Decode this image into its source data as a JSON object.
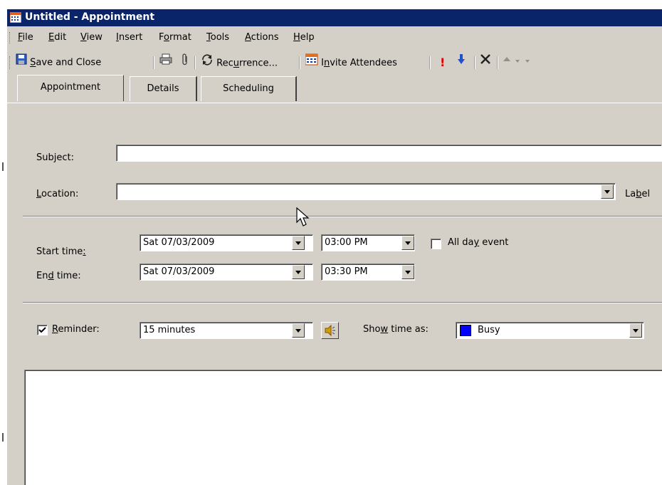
{
  "window": {
    "title": "Untitled - Appointment"
  },
  "menu": [
    "File",
    "Edit",
    "View",
    "Insert",
    "Format",
    "Tools",
    "Actions",
    "Help"
  ],
  "toolbar": {
    "save_close": "Save and Close",
    "recurrence": "Recurrence...",
    "invite": "Invite Attendees"
  },
  "tabs": [
    "Appointment",
    "Details",
    "Scheduling"
  ],
  "form": {
    "subject_label": "Subject:",
    "subject_value": "",
    "location_label": "Location:",
    "location_value": "",
    "label_label": "Label",
    "start_label": "Start time:",
    "start_date": "Sat 07/03/2009",
    "start_time": "03:00 PM",
    "all_day_label": "All day event",
    "all_day_checked": false,
    "end_label": "End time:",
    "end_date": "Sat 07/03/2009",
    "end_time": "03:30 PM",
    "reminder_label": "Reminder:",
    "reminder_checked": true,
    "reminder_value": "15 minutes",
    "show_time_label": "Show time as:",
    "show_time_value": "Busy",
    "busy_color": "#0000ff"
  },
  "icons": {
    "app": "calendar-icon",
    "save": "floppy-disk-icon",
    "print": "printer-icon",
    "attach": "paperclip-icon",
    "recurrence": "recurrence-arrows-icon",
    "invite": "calendar-invite-icon",
    "high_importance": "exclamation-icon",
    "low_importance": "down-arrow-icon",
    "delete": "delete-x-icon",
    "up": "up-arrow-icon",
    "sound": "speaker-icon"
  },
  "colors": {
    "title_bar": "#0a246a",
    "face": "#d4d0c8",
    "importance_red": "#e00000",
    "low_blue": "#2050d0"
  }
}
